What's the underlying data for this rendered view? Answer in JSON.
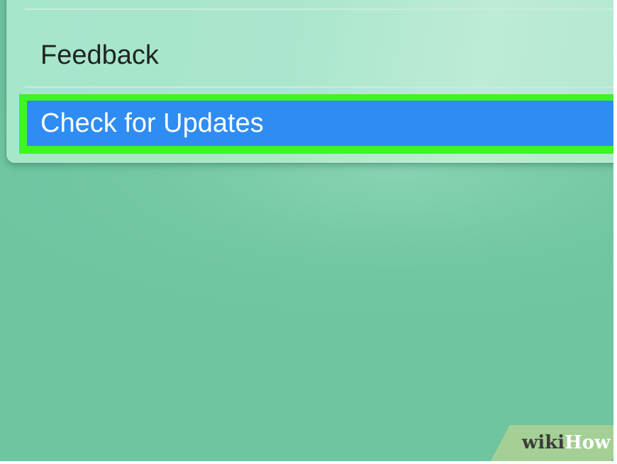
{
  "menu": {
    "items": [
      {
        "label": "Feedback",
        "highlighted": false
      },
      {
        "label": "Check for Updates",
        "highlighted": true
      }
    ],
    "highlight_color": "#2f8cf2",
    "annotation_outline_color": "#3df521"
  },
  "watermark": {
    "part1": "wiki",
    "part2": "How"
  }
}
